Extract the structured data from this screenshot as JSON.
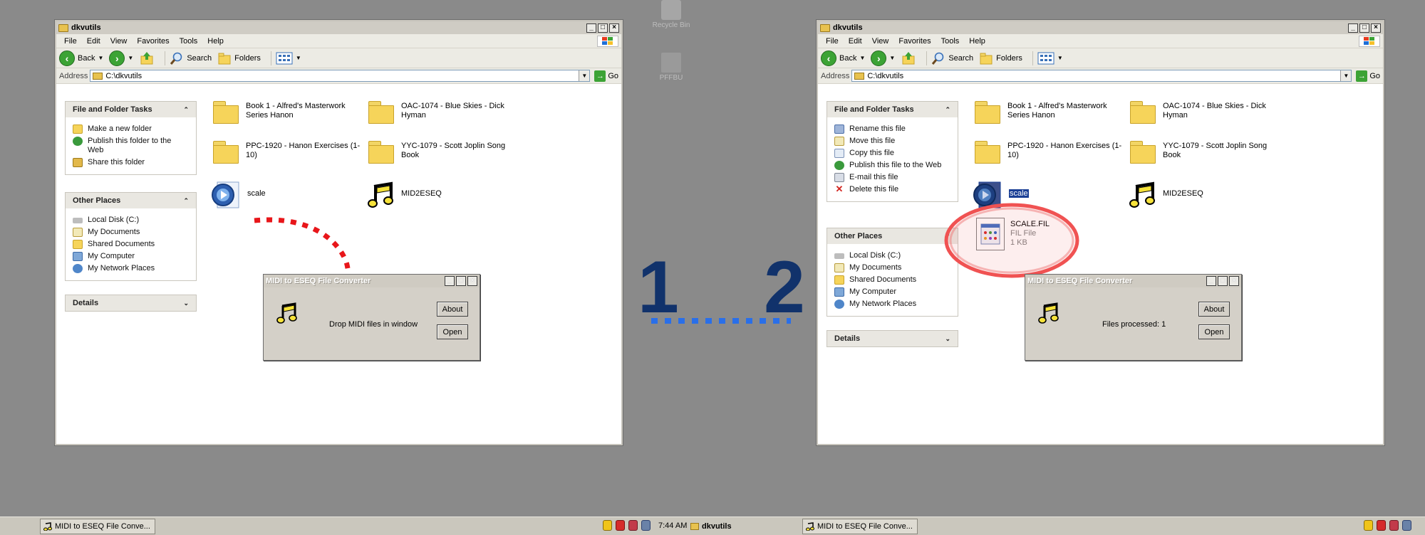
{
  "desktop": {
    "icons": [
      {
        "label": "Recycle Bin",
        "icon": "recycle-bin-icon"
      },
      {
        "label": "PFFBU",
        "icon": "floppy-icon"
      }
    ]
  },
  "window_left": {
    "title": "dkvutils",
    "menu": [
      "File",
      "Edit",
      "View",
      "Favorites",
      "Tools",
      "Help"
    ],
    "toolbar": {
      "back": "Back",
      "search": "Search",
      "folders": "Folders"
    },
    "address": {
      "label": "Address",
      "value": "C:\\dkvutils",
      "go": "Go"
    },
    "tasks": {
      "title": "File and Folder Tasks",
      "items": [
        "Make a new folder",
        "Publish this folder to the Web",
        "Share this folder"
      ]
    },
    "places": {
      "title": "Other Places",
      "items": [
        "Local Disk (C:)",
        "My Documents",
        "Shared Documents",
        "My Computer",
        "My Network Places"
      ]
    },
    "details": {
      "title": "Details"
    },
    "files": [
      {
        "name": "Book 1 - Alfred's Masterwork Series Hanon",
        "kind": "folder"
      },
      {
        "name": "OAC-1074 - Blue Skies - Dick Hyman",
        "kind": "folder"
      },
      {
        "name": "PPC-1920 - Hanon Exercises (1-10)",
        "kind": "folder"
      },
      {
        "name": "YYC-1079 - Scott Joplin Song Book",
        "kind": "folder"
      },
      {
        "name": "scale",
        "kind": "media"
      },
      {
        "name": "MID2ESEQ",
        "kind": "note"
      }
    ],
    "dialog": {
      "title": "MIDI to ESEQ File Converter",
      "message": "Drop MIDI files in window",
      "about": "About",
      "open": "Open"
    }
  },
  "window_right": {
    "title": "dkvutils",
    "menu": [
      "File",
      "Edit",
      "View",
      "Favorites",
      "Tools",
      "Help"
    ],
    "toolbar": {
      "back": "Back",
      "search": "Search",
      "folders": "Folders"
    },
    "address": {
      "label": "Address",
      "value": "C:\\dkvutils",
      "go": "Go"
    },
    "tasks": {
      "title": "File and Folder Tasks",
      "items": [
        "Rename this file",
        "Move this file",
        "Copy this file",
        "Publish this file to the Web",
        "E-mail this file",
        "Delete this file"
      ]
    },
    "places": {
      "title": "Other Places",
      "items": [
        "Local Disk (C:)",
        "My Documents",
        "Shared Documents",
        "My Computer",
        "My Network Places"
      ]
    },
    "details": {
      "title": "Details"
    },
    "files": [
      {
        "name": "Book 1 - Alfred's Masterwork Series Hanon",
        "kind": "folder"
      },
      {
        "name": "OAC-1074 - Blue Skies - Dick Hyman",
        "kind": "folder"
      },
      {
        "name": "PPC-1920 - Hanon Exercises (1-10)",
        "kind": "folder"
      },
      {
        "name": "YYC-1079 - Scott Joplin Song Book",
        "kind": "folder"
      },
      {
        "name": "scale",
        "kind": "media",
        "selected": true
      },
      {
        "name": "MID2ESEQ",
        "kind": "note"
      },
      {
        "name": "SCALE.FIL",
        "kind": "fil",
        "type": "FIL File",
        "size": "1 KB"
      }
    ],
    "dialog": {
      "title": "MIDI to ESEQ File Converter",
      "message": "Files processed: 1",
      "about": "About",
      "open": "Open"
    }
  },
  "steps": {
    "one": "1",
    "two": "2"
  },
  "taskbar": {
    "left_task": "MIDI to ESEQ File Conve...",
    "clock": "7:44 AM",
    "mid_task": "dkvutils",
    "right_task": "MIDI to ESEQ File Conve..."
  },
  "colors": {
    "highlight": "#1a3f95",
    "dotted_blue": "#2a6fe8",
    "dotted_red": "#e8161a",
    "number_blue": "#11326b"
  }
}
